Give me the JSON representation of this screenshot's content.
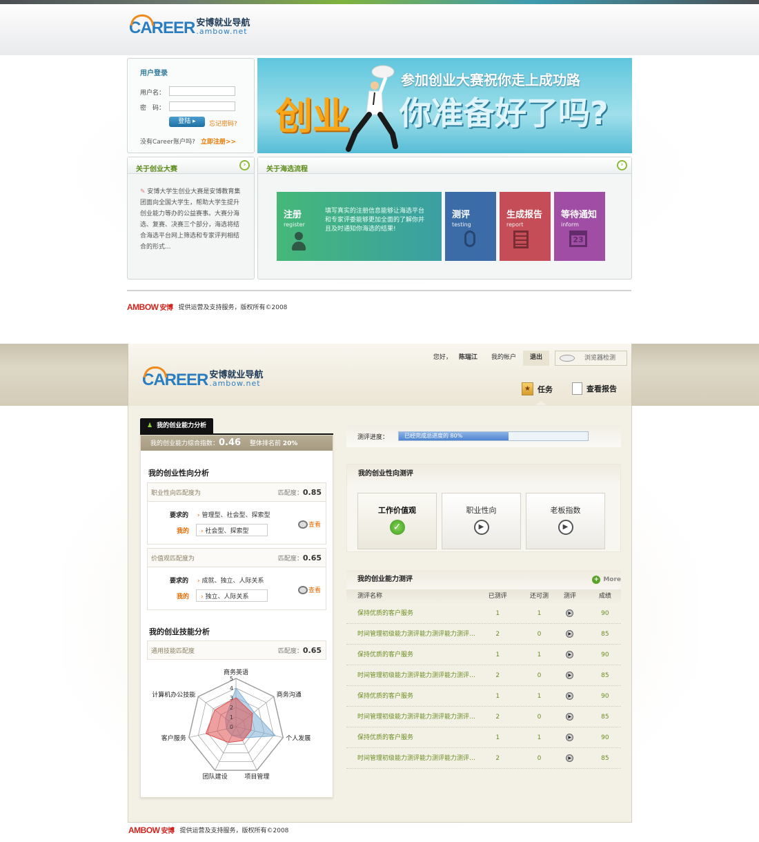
{
  "top": {
    "logo": {
      "mark": "CAREER",
      "cn": "安博就业导航",
      "en": ".ambow.net"
    },
    "login": {
      "title": "用户登录",
      "username_label": "用户名：",
      "password_label": "密　码：",
      "login_button": "登陆",
      "forgot": "忘记密码?",
      "no_account": "没有Career账户吗?",
      "register_now": "立即注册>>"
    },
    "banner": {
      "headline": "参加创业大赛祝你走上成功路",
      "big_left": "创业",
      "big_right": "你准备好了吗?"
    },
    "about": {
      "title": "关于创业大赛",
      "body": "安博大学生创业大赛是安博教育集团面向全国大学生，帮助大学生提升创业能力等办的公益赛事。大赛分海选、复赛、决赛三个部分，海选将结合海选平台网上筛选和专家评判相结合的形式..."
    },
    "process": {
      "title": "关于海选流程",
      "steps": [
        {
          "name": "注册",
          "en": "register",
          "desc": "填写真实的注册信息能够让海选平台和专家评委能够更加全面的了解你并且及时通知你海选的结果!",
          "color": "#3fae86"
        },
        {
          "name": "测评",
          "en": "testing",
          "color": "#3c6ca8"
        },
        {
          "name": "生成报告",
          "en": "report",
          "color": "#c44d57"
        },
        {
          "name": "等待通知",
          "en": "inform",
          "color": "#a04ea5",
          "calendar_day": "23"
        }
      ]
    },
    "footer": {
      "brand": "AMBOW",
      "brand_cn": "安博",
      "text": "提供运营及支持服务，版权所有©2008"
    }
  },
  "bottom": {
    "logo": {
      "mark": "CAREER",
      "cn": "安博就业导航",
      "en": ".ambow.net"
    },
    "userbar": {
      "greeting": "您好，",
      "username": "陈瑞江",
      "account": "我的帐户",
      "logout": "退出",
      "browser_check": "浏览器检测"
    },
    "nav": {
      "task": "任务",
      "report": "查看报告"
    },
    "left": {
      "tab": "我的创业能力分析",
      "score_label": "我的创业能力综合指数：",
      "score": "0.46",
      "rank_label": "整体排名前",
      "rank": "20%",
      "orientation_title": "我的创业性向分析",
      "match_label": "匹配度：",
      "blocks": [
        {
          "name": "职业性向匹配度为",
          "score": "0.85",
          "req_label": "要求的",
          "req": "管理型、社会型、探索型",
          "mine_label": "我的",
          "mine": "社会型、探索型",
          "view": "查看"
        },
        {
          "name": "价值观匹配度为",
          "score": "0.65",
          "req_label": "要求的",
          "req": "成就、独立、人际关系",
          "mine_label": "我的",
          "mine": "独立、人际关系",
          "view": "查看"
        }
      ],
      "skill_title": "我的创业技能分析",
      "skill_row": {
        "name": "通用技能匹配度",
        "score": "0.65"
      }
    },
    "right": {
      "progress_label": "测评进度：",
      "progress_text": "已经完成总进度的 80%",
      "progress": 0.58,
      "orientation_test_title": "我的创业性向测评",
      "tests": [
        {
          "name": "工作价值观",
          "done": true
        },
        {
          "name": "职业性向",
          "done": false
        },
        {
          "name": "老板指数",
          "done": false
        }
      ],
      "ability_title": "我的创业能力测评",
      "more": "More",
      "table_headers": [
        "测评名称",
        "已测评",
        "还可测",
        "测评",
        "成绩"
      ],
      "rows": [
        [
          "保持优质的客户服务",
          "1",
          "1",
          "90"
        ],
        [
          "时间管理初级能力测评能力测评能力测评习惯...",
          "2",
          "0",
          "85"
        ],
        [
          "保持优质的客户服务",
          "1",
          "1",
          "90"
        ],
        [
          "时间管理初级能力测评能力测评能力测评习惯...",
          "2",
          "0",
          "85"
        ],
        [
          "保持优质的客户服务",
          "1",
          "1",
          "90"
        ],
        [
          "时间管理初级能力测评能力测评能力测评习惯...",
          "2",
          "0",
          "85"
        ],
        [
          "保持优质的客户服务",
          "1",
          "1",
          "90"
        ],
        [
          "时间管理初级能力测评能力测评能力测评习惯...",
          "2",
          "0",
          "85"
        ]
      ]
    },
    "footer": {
      "brand": "AMBOW",
      "brand_cn": "安博",
      "text": "提供运营及支持服务，版权所有©2008"
    }
  },
  "chart_data": {
    "type": "radar",
    "categories": [
      "商务英语",
      "商务沟通",
      "个人发展",
      "项目管理",
      "团队建设",
      "客户服务",
      "计算机办公技能"
    ],
    "ticks": [
      "0",
      "1",
      "2",
      "3",
      "4",
      "5"
    ],
    "ylim": [
      0,
      5
    ],
    "series": [
      {
        "color": "#e05050",
        "values": [
          3,
          2.2,
          1.6,
          1.6,
          1.8,
          3.2,
          2.8
        ]
      },
      {
        "color": "#7fb0d6",
        "values": [
          4,
          2.4,
          4.2,
          1.3,
          1.0,
          1.0,
          1.4
        ]
      }
    ]
  }
}
